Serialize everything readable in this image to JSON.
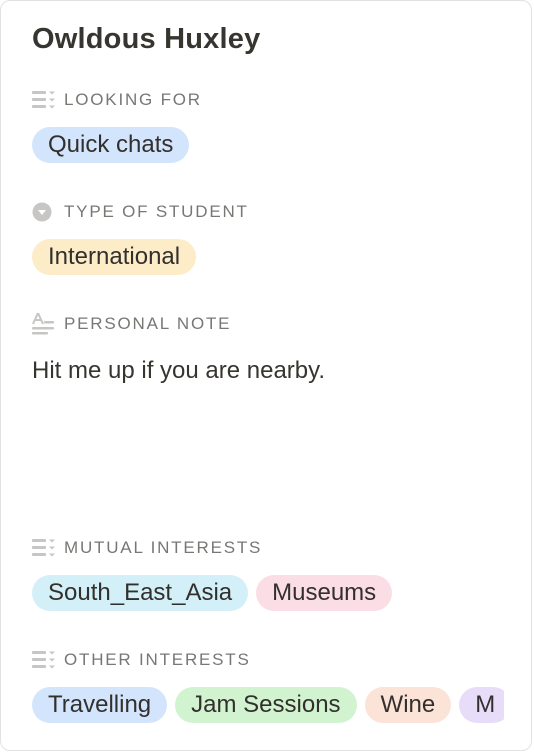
{
  "profile": {
    "name": "Owldous Huxley"
  },
  "fields": {
    "looking_for": {
      "label": "LOOKING FOR",
      "icon": "multi-select-icon",
      "tags": [
        {
          "text": "Quick chats",
          "color": "#d3e5fd"
        }
      ]
    },
    "type_of_student": {
      "label": "TYPE OF STUDENT",
      "icon": "select-icon",
      "tags": [
        {
          "text": "International",
          "color": "#fdecc8"
        }
      ]
    },
    "personal_note": {
      "label": "PERSONAL NOTE",
      "icon": "text-icon",
      "value": "Hit me up if you are nearby."
    },
    "mutual_interests": {
      "label": "MUTUAL INTERESTS",
      "icon": "multi-select-icon",
      "tags": [
        {
          "text": "South_East_Asia",
          "color": "#d3f0f8"
        },
        {
          "text": "Museums",
          "color": "#fbdde6"
        }
      ]
    },
    "other_interests": {
      "label": "OTHER INTERESTS",
      "icon": "multi-select-icon",
      "tags": [
        {
          "text": "Travelling",
          "color": "#d3e5fd"
        },
        {
          "text": "Jam Sessions",
          "color": "#d2f3d0"
        },
        {
          "text": "Wine",
          "color": "#fbe3d8"
        },
        {
          "text": "M",
          "color": "#e8ddf8"
        }
      ]
    }
  }
}
